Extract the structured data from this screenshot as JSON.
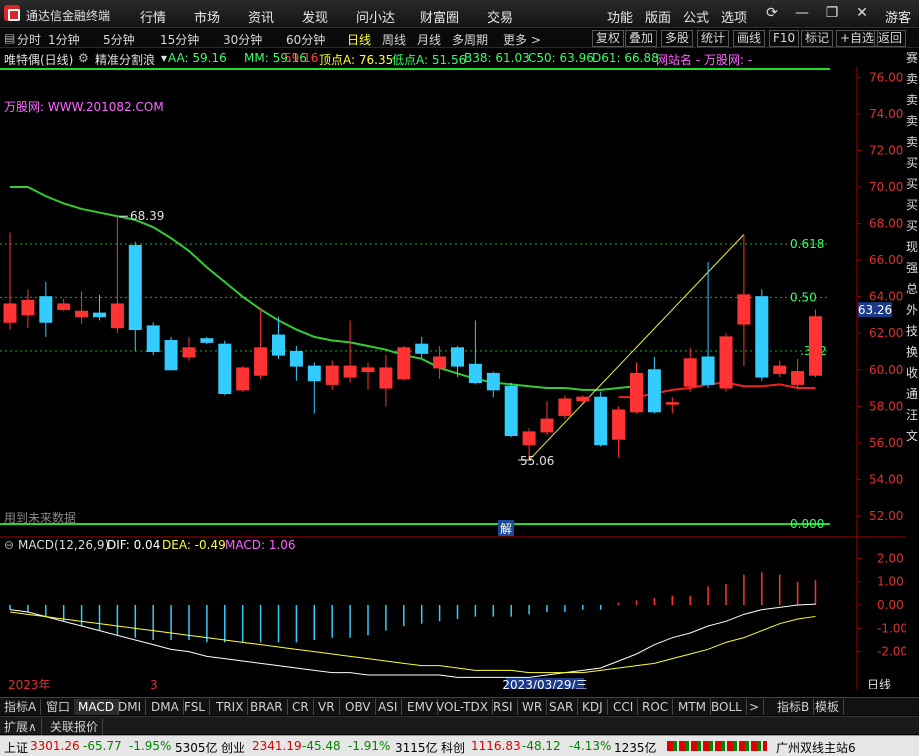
{
  "titlebar": {
    "app_name": "通达信金融终端",
    "menus": [
      "行情",
      "市场",
      "资讯",
      "发现",
      "问小达",
      "财富圈",
      "交易"
    ],
    "tools": [
      "功能",
      "版面",
      "公式",
      "选项"
    ],
    "guest": "游客"
  },
  "toolbar": {
    "periods": [
      "分时",
      "1分钟",
      "5分钟",
      "15分钟",
      "30分钟",
      "60分钟",
      "日线",
      "周线",
      "月线",
      "多周期",
      "更多 >"
    ],
    "selected_period": "日线",
    "actions": [
      "复权",
      "叠加",
      "多股",
      "统计",
      "画线",
      "F10",
      "标记",
      "+自选",
      "返回"
    ]
  },
  "info": {
    "stock": "唯特偶(日线)",
    "indicator": "精准分割浪",
    "aa": "AA: 59.16",
    "mm": "MM: 59.16",
    "price": "59.16",
    "top": "顶点A: 76.35",
    "low": "低点A: 51.56",
    "b38": "B38: 61.03",
    "c50": "C50: 63.96",
    "d61": "D61: 66.88",
    "site": "网站名 - 万股网: -",
    "watermark": "万股网: WWW.201082.COM",
    "future_note": "用到未来数据",
    "jie": "解"
  },
  "main_axis": {
    "labels": [
      "76.00",
      "74.00",
      "72.00",
      "70.00",
      "68.00",
      "66.00",
      "64.00",
      "62.00",
      "60.00",
      "58.00",
      "56.00",
      "54.00",
      "52.00"
    ],
    "current": "63.26",
    "fib": [
      "0.618",
      "0.50",
      ".382",
      "0.000"
    ],
    "high_label": "68.39",
    "low_label": "55.06"
  },
  "macd": {
    "title": "MACD(12,26,9)",
    "dif": "DIF: 0.04",
    "dea": "DEA: -0.49",
    "macd": "MACD: 1.06",
    "labels": [
      "2.00",
      "1.00",
      "0.00",
      "-1.00",
      "-2.00"
    ],
    "period": "日线"
  },
  "dates": {
    "year": "2023年",
    "month": "3",
    "cursor": "2023/03/29/三"
  },
  "bottom_tabs": [
    "指标A",
    "窗口",
    "MACD",
    "DMI",
    "DMA",
    "FSL",
    "TRIX",
    "BRAR",
    "CR",
    "VR",
    "OBV",
    "ASI",
    "EMV",
    "VOL-TDX",
    "RSI",
    "WR",
    "SAR",
    "KDJ",
    "CCI",
    "ROC",
    "MTM",
    "BOLL",
    ">",
    "指标B",
    "模板"
  ],
  "expand_bar": [
    "扩展∧",
    "关联报价"
  ],
  "status": {
    "sh_name": "上证",
    "sh_price": "3301.26",
    "sh_chg": "-65.77",
    "sh_pct": "-1.95%",
    "sh_amt": "5305亿",
    "cy_name": "创业",
    "cy_price": "2341.19",
    "cy_chg": "-45.48",
    "cy_pct": "-1.91%",
    "cy_amt": "3115亿",
    "kc_name": "科创",
    "kc_price": "1116.83",
    "kc_chg": "-48.12",
    "kc_pct": "-4.13%",
    "kc_amt": "1235亿",
    "server": "广州双线主站6"
  },
  "side_text": [
    "赛",
    "卖",
    "卖",
    "卖",
    "卖",
    "买",
    "买",
    "买",
    "买",
    "现",
    "强",
    "总",
    "外",
    "技",
    "换",
    "收",
    "通",
    "汪",
    "文"
  ],
  "chart_data": {
    "type": "candlestick",
    "candles": [
      {
        "o": 62.6,
        "c": 63.6,
        "h": 67.5,
        "l": 62.2
      },
      {
        "o": 63.0,
        "c": 63.8,
        "h": 64.4,
        "l": 62.3
      },
      {
        "o": 64.0,
        "c": 62.6,
        "h": 64.8,
        "l": 61.8
      },
      {
        "o": 63.3,
        "c": 63.6,
        "h": 63.9,
        "l": 63.2
      },
      {
        "o": 62.9,
        "c": 63.2,
        "h": 64.3,
        "l": 62.5
      },
      {
        "o": 63.1,
        "c": 62.9,
        "h": 64.1,
        "l": 62.7
      },
      {
        "o": 62.3,
        "c": 63.6,
        "h": 68.4,
        "l": 62.0
      },
      {
        "o": 66.8,
        "c": 62.2,
        "h": 67.0,
        "l": 61.0
      },
      {
        "o": 62.4,
        "c": 61.0,
        "h": 62.6,
        "l": 60.8
      },
      {
        "o": 61.6,
        "c": 60.0,
        "h": 61.8,
        "l": 60.0
      },
      {
        "o": 60.7,
        "c": 61.2,
        "h": 61.8,
        "l": 60.5
      },
      {
        "o": 61.7,
        "c": 61.5,
        "h": 61.8,
        "l": 61.4
      },
      {
        "o": 61.4,
        "c": 58.7,
        "h": 61.6,
        "l": 58.6
      },
      {
        "o": 58.9,
        "c": 60.1,
        "h": 60.2,
        "l": 58.8
      },
      {
        "o": 59.7,
        "c": 61.2,
        "h": 63.4,
        "l": 59.5
      },
      {
        "o": 61.9,
        "c": 60.8,
        "h": 62.9,
        "l": 60.6
      },
      {
        "o": 61.0,
        "c": 60.2,
        "h": 61.3,
        "l": 59.4
      },
      {
        "o": 60.2,
        "c": 59.4,
        "h": 60.4,
        "l": 57.6
      },
      {
        "o": 59.2,
        "c": 60.2,
        "h": 60.5,
        "l": 58.9
      },
      {
        "o": 59.6,
        "c": 60.2,
        "h": 62.7,
        "l": 59.3
      },
      {
        "o": 59.9,
        "c": 60.1,
        "h": 60.4,
        "l": 58.9
      },
      {
        "o": 59.0,
        "c": 60.1,
        "h": 60.8,
        "l": 58.0
      },
      {
        "o": 59.5,
        "c": 61.2,
        "h": 61.3,
        "l": 59.4
      },
      {
        "o": 61.4,
        "c": 60.9,
        "h": 61.8,
        "l": 60.6
      },
      {
        "o": 60.1,
        "c": 60.7,
        "h": 61.3,
        "l": 59.5
      },
      {
        "o": 61.2,
        "c": 60.2,
        "h": 61.3,
        "l": 59.6
      },
      {
        "o": 60.3,
        "c": 59.3,
        "h": 62.7,
        "l": 59.2
      },
      {
        "o": 59.8,
        "c": 58.9,
        "h": 59.9,
        "l": 58.5
      },
      {
        "o": 59.1,
        "c": 56.4,
        "h": 59.3,
        "l": 56.3
      },
      {
        "o": 55.9,
        "c": 56.6,
        "h": 56.8,
        "l": 55.1
      },
      {
        "o": 56.6,
        "c": 57.3,
        "h": 58.3,
        "l": 56.4
      },
      {
        "o": 57.5,
        "c": 58.4,
        "h": 58.6,
        "l": 57.3
      },
      {
        "o": 58.3,
        "c": 58.5,
        "h": 58.6,
        "l": 58.2
      },
      {
        "o": 58.5,
        "c": 55.9,
        "h": 58.8,
        "l": 55.8
      },
      {
        "o": 56.2,
        "c": 57.8,
        "h": 58.0,
        "l": 55.2
      },
      {
        "o": 57.7,
        "c": 59.8,
        "h": 60.4,
        "l": 57.6
      },
      {
        "o": 60.0,
        "c": 57.7,
        "h": 60.7,
        "l": 57.6
      },
      {
        "o": 58.2,
        "c": 58.2,
        "h": 58.5,
        "l": 57.6
      },
      {
        "o": 59.1,
        "c": 60.6,
        "h": 61.2,
        "l": 58.8
      },
      {
        "o": 60.7,
        "c": 59.2,
        "h": 65.9,
        "l": 59.0
      },
      {
        "o": 59.0,
        "c": 61.8,
        "h": 62.0,
        "l": 58.8
      },
      {
        "o": 62.5,
        "c": 64.1,
        "h": 67.4,
        "l": 60.2
      },
      {
        "o": 64.0,
        "c": 59.6,
        "h": 64.4,
        "l": 59.4
      },
      {
        "o": 59.8,
        "c": 60.2,
        "h": 60.5,
        "l": 59.6
      },
      {
        "o": 59.2,
        "c": 59.9,
        "h": 60.6,
        "l": 59.0
      },
      {
        "o": 59.7,
        "c": 62.9,
        "h": 63.3,
        "l": 59.6
      }
    ],
    "ma": [
      70.0,
      70.0,
      69.5,
      69.1,
      68.8,
      68.6,
      68.4,
      68.2,
      67.8,
      67.2,
      66.5,
      65.6,
      64.8,
      64.0,
      63.3,
      62.7,
      62.2,
      61.8,
      61.6,
      61.5,
      61.3,
      61.1,
      60.8,
      60.6,
      60.1,
      59.8,
      59.5,
      59.3,
      59.2,
      59.1,
      59.0,
      59.0,
      58.9,
      58.9,
      59.0,
      59.1
    ],
    "ma2": [
      58.5,
      58.5,
      58.7,
      58.9,
      59.0,
      59.2,
      59.3,
      59.1,
      59.1,
      59.2,
      59.0,
      59.0
    ],
    "dif": [
      -0.2,
      -0.3,
      -0.5,
      -0.7,
      -0.9,
      -1.1,
      -1.3,
      -1.5,
      -1.7,
      -1.9,
      -2.0,
      -2.2,
      -2.3,
      -2.4,
      -2.5,
      -2.6,
      -2.7,
      -2.8,
      -2.9,
      -2.9,
      -3.0,
      -3.0,
      -3.0,
      -3.0,
      -3.0,
      -3.1,
      -3.1,
      -3.1,
      -3.1,
      -3.1,
      -3.0,
      -2.9,
      -2.8,
      -2.7,
      -2.4,
      -2.1,
      -1.7,
      -1.4,
      -1.2,
      -0.9,
      -0.7,
      -0.4,
      -0.2,
      -0.1,
      0.0,
      0.04
    ],
    "dea": [
      -0.3,
      -0.4,
      -0.5,
      -0.6,
      -0.7,
      -0.8,
      -0.9,
      -1.0,
      -1.1,
      -1.2,
      -1.3,
      -1.4,
      -1.5,
      -1.6,
      -1.7,
      -1.8,
      -1.9,
      -2.0,
      -2.1,
      -2.2,
      -2.3,
      -2.4,
      -2.5,
      -2.6,
      -2.6,
      -2.7,
      -2.8,
      -2.8,
      -2.8,
      -2.9,
      -2.9,
      -2.9,
      -2.9,
      -2.8,
      -2.7,
      -2.6,
      -2.5,
      -2.3,
      -2.1,
      -1.9,
      -1.6,
      -1.4,
      -1.1,
      -0.8,
      -0.6,
      -0.49
    ],
    "hist": [
      -0.2,
      -0.3,
      -0.5,
      -0.7,
      -0.9,
      -1.1,
      -1.3,
      -1.4,
      -1.5,
      -1.5,
      -1.5,
      -1.6,
      -1.6,
      -1.6,
      -1.6,
      -1.6,
      -1.6,
      -1.5,
      -1.4,
      -1.4,
      -1.3,
      -1.1,
      -0.9,
      -0.8,
      -0.7,
      -0.6,
      -0.5,
      -0.5,
      -0.5,
      -0.4,
      -0.3,
      -0.3,
      -0.2,
      -0.2,
      0.1,
      0.2,
      0.3,
      0.4,
      0.4,
      0.8,
      0.9,
      1.3,
      1.4,
      1.3,
      1.0,
      1.06
    ]
  }
}
